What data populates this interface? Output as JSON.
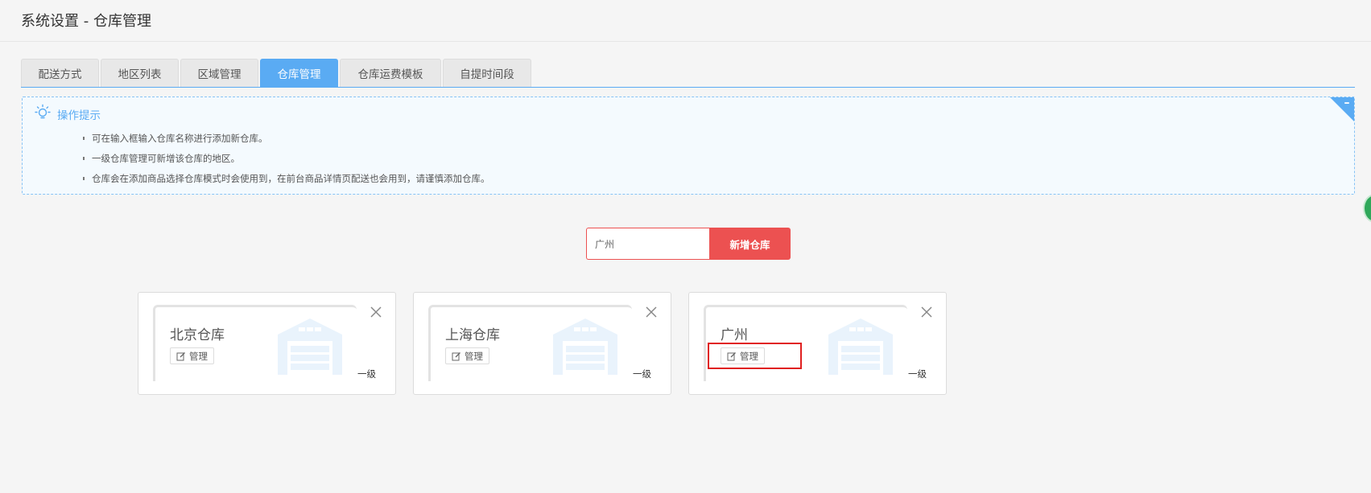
{
  "page": {
    "title": "系统设置 - 仓库管理"
  },
  "tabs": [
    {
      "label": "配送方式",
      "active": false
    },
    {
      "label": "地区列表",
      "active": false
    },
    {
      "label": "区域管理",
      "active": false
    },
    {
      "label": "仓库管理",
      "active": true
    },
    {
      "label": "仓库运费模板",
      "active": false
    },
    {
      "label": "自提时间段",
      "active": false
    }
  ],
  "tips": {
    "title": "操作提示",
    "icon": "lightbulb-icon",
    "items": [
      "可在输入框输入仓库名称进行添加新仓库。",
      "一级仓库管理可新增该仓库的地区。",
      "仓库会在添加商品选择仓库模式时会使用到，在前台商品详情页配送也会用到，请谨慎添加仓库。"
    ]
  },
  "add_form": {
    "input_value": "广州",
    "button_label": "新增仓库"
  },
  "warehouses": [
    {
      "name": "北京仓库",
      "manage_label": "管理",
      "level": "一级"
    },
    {
      "name": "上海仓库",
      "manage_label": "管理",
      "level": "一级"
    },
    {
      "name": "广州",
      "manage_label": "管理",
      "level": "一级"
    }
  ],
  "colors": {
    "accent": "#5aabf3",
    "danger": "#ec5151",
    "highlight": "#e02020"
  }
}
